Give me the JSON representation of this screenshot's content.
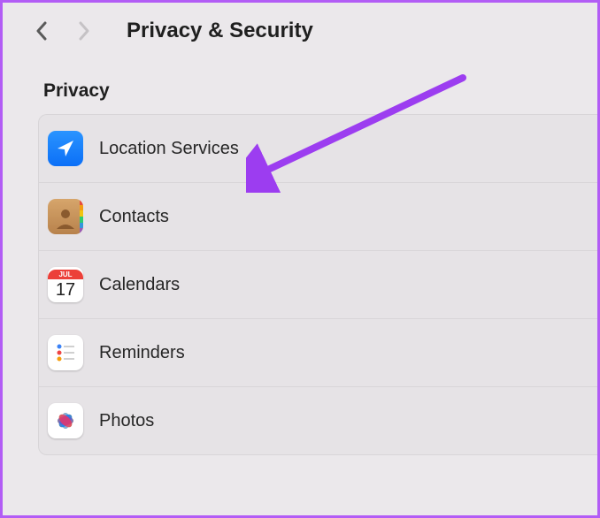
{
  "header": {
    "title": "Privacy & Security"
  },
  "section": {
    "title": "Privacy"
  },
  "items": [
    {
      "id": "location-services",
      "label": "Location Services"
    },
    {
      "id": "contacts",
      "label": "Contacts"
    },
    {
      "id": "calendars",
      "label": "Calendars",
      "dateNum": "17",
      "dateMonth": "JUL"
    },
    {
      "id": "reminders",
      "label": "Reminders"
    },
    {
      "id": "photos",
      "label": "Photos"
    }
  ],
  "annotation": {
    "color": "#9c3df0"
  }
}
